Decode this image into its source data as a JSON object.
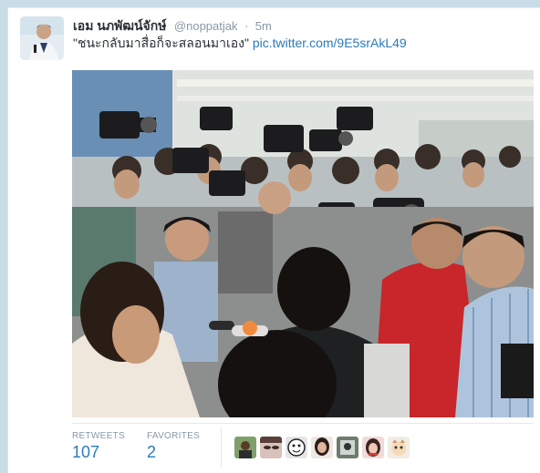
{
  "tweet": {
    "fullname": "เอม นภพัฒน์จักษ์",
    "username": "@noppatjak",
    "separator": "·",
    "time": "5m",
    "text": "\"ชนะกลับมาสื่อก็จะสลอนมาเอง\"",
    "link": "pic.twitter.com/9E5srAkL49"
  },
  "stats": {
    "retweets_label": "RETWEETS",
    "retweets_count": "107",
    "favorites_label": "FAVORITES",
    "favorites_count": "2"
  },
  "favoriters": [
    {
      "name": "favoriter-avatar-1"
    },
    {
      "name": "favoriter-avatar-2"
    },
    {
      "name": "favoriter-avatar-3"
    },
    {
      "name": "favoriter-avatar-4"
    },
    {
      "name": "favoriter-avatar-5"
    },
    {
      "name": "favoriter-avatar-6"
    },
    {
      "name": "favoriter-avatar-7"
    }
  ],
  "colors": {
    "link": "#2b7bb9",
    "name": "#292f33",
    "muted": "#8899a6",
    "background": "#c9dde9"
  }
}
